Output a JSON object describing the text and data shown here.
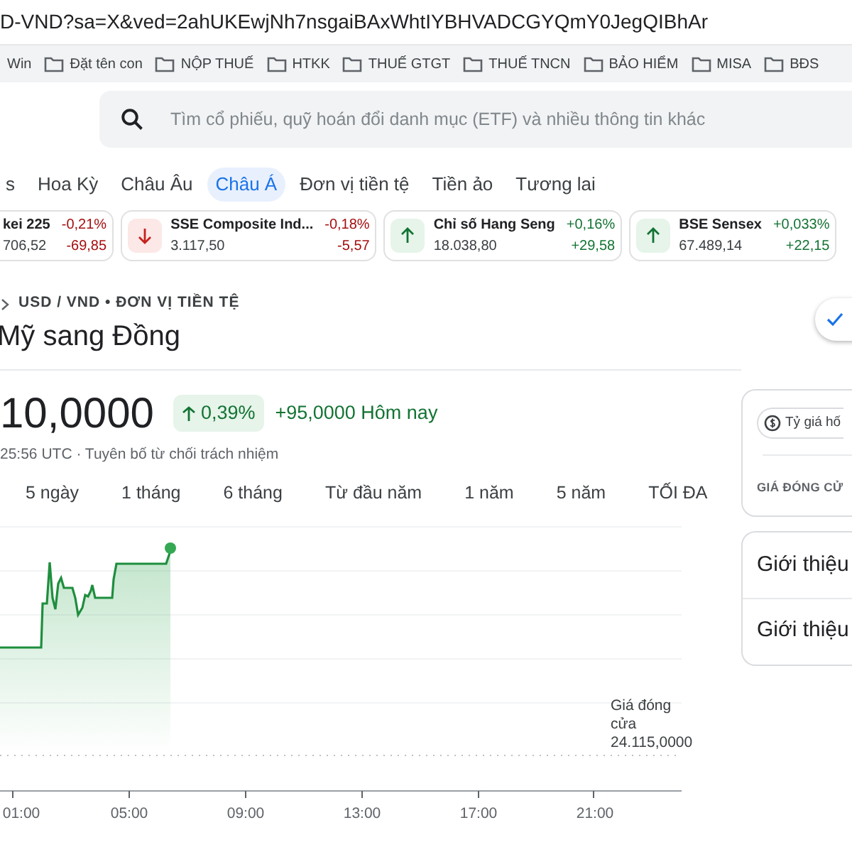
{
  "url": "D-VND?sa=X&ved=2ahUKEwjNh7nsgaiBAxWhtIYBHVADCGYQmY0JegQIBhAr",
  "bookmarks": [
    {
      "label": "Win",
      "kind": "link"
    },
    {
      "label": "Đặt tên con",
      "kind": "folder"
    },
    {
      "label": "NỘP THUẾ",
      "kind": "folder"
    },
    {
      "label": "HTKK",
      "kind": "folder"
    },
    {
      "label": "THUẾ GTGT",
      "kind": "folder"
    },
    {
      "label": "THUẾ TNCN",
      "kind": "folder"
    },
    {
      "label": "BẢO HIỂM",
      "kind": "folder"
    },
    {
      "label": "MISA",
      "kind": "folder"
    },
    {
      "label": "BĐS",
      "kind": "folder"
    }
  ],
  "search": {
    "placeholder": "Tìm cổ phiếu, quỹ hoán đổi danh mục (ETF) và nhiều thông tin khác"
  },
  "region_tabs": [
    {
      "label": "s",
      "selected": false
    },
    {
      "label": "Hoa Kỳ",
      "selected": false
    },
    {
      "label": "Châu Âu",
      "selected": false
    },
    {
      "label": "Châu Á",
      "selected": true
    },
    {
      "label": "Đơn vị tiền tệ",
      "selected": false
    },
    {
      "label": "Tiền ảo",
      "selected": false
    },
    {
      "label": "Tương lai",
      "selected": false
    }
  ],
  "tickers": [
    {
      "name": "kei 225",
      "price": "706,52",
      "percent": "-0,21%",
      "change": "-69,85",
      "up": false
    },
    {
      "name": "SSE Composite Ind...",
      "price": "3.117,50",
      "percent": "-0,18%",
      "change": "-5,57",
      "up": false
    },
    {
      "name": "Chỉ số Hang Seng",
      "price": "18.038,80",
      "percent": "+0,16%",
      "change": "+29,58",
      "up": true
    },
    {
      "name": "BSE Sensex",
      "price": "67.489,14",
      "percent": "+0,033%",
      "change": "+22,15",
      "up": true
    }
  ],
  "breadcrumb": "USD / VND • ĐƠN VỊ TIỀN TỆ",
  "title": "Mỹ sang Đồng",
  "price": "10,0000",
  "change_percent": "0,39%",
  "change_today": "+95,0000 Hôm nay",
  "timestamp": "25:56 UTC · Tuyên bố từ chối trách nhiệm",
  "range_tabs": [
    {
      "label": "5 ngày",
      "selected": false
    },
    {
      "label": "1 tháng",
      "selected": false
    },
    {
      "label": "6 tháng",
      "selected": false
    },
    {
      "label": "Từ đầu năm",
      "selected": false
    },
    {
      "label": "1 năm",
      "selected": false
    },
    {
      "label": "5 năm",
      "selected": false
    },
    {
      "label": "TỐI ĐA",
      "selected": false
    }
  ],
  "chart": {
    "previous_close_label": "Giá đóng cửa",
    "previous_close_value": "24.115,0000",
    "x_labels": [
      "01:00",
      "05:00",
      "09:00",
      "13:00",
      "17:00",
      "21:00"
    ]
  },
  "side_panel": {
    "chip": "Tỷ giá hố",
    "section_label": "GIÁ ĐÓNG CỬ",
    "about": [
      "Giới thiệu",
      "Giới thiệu"
    ]
  }
}
